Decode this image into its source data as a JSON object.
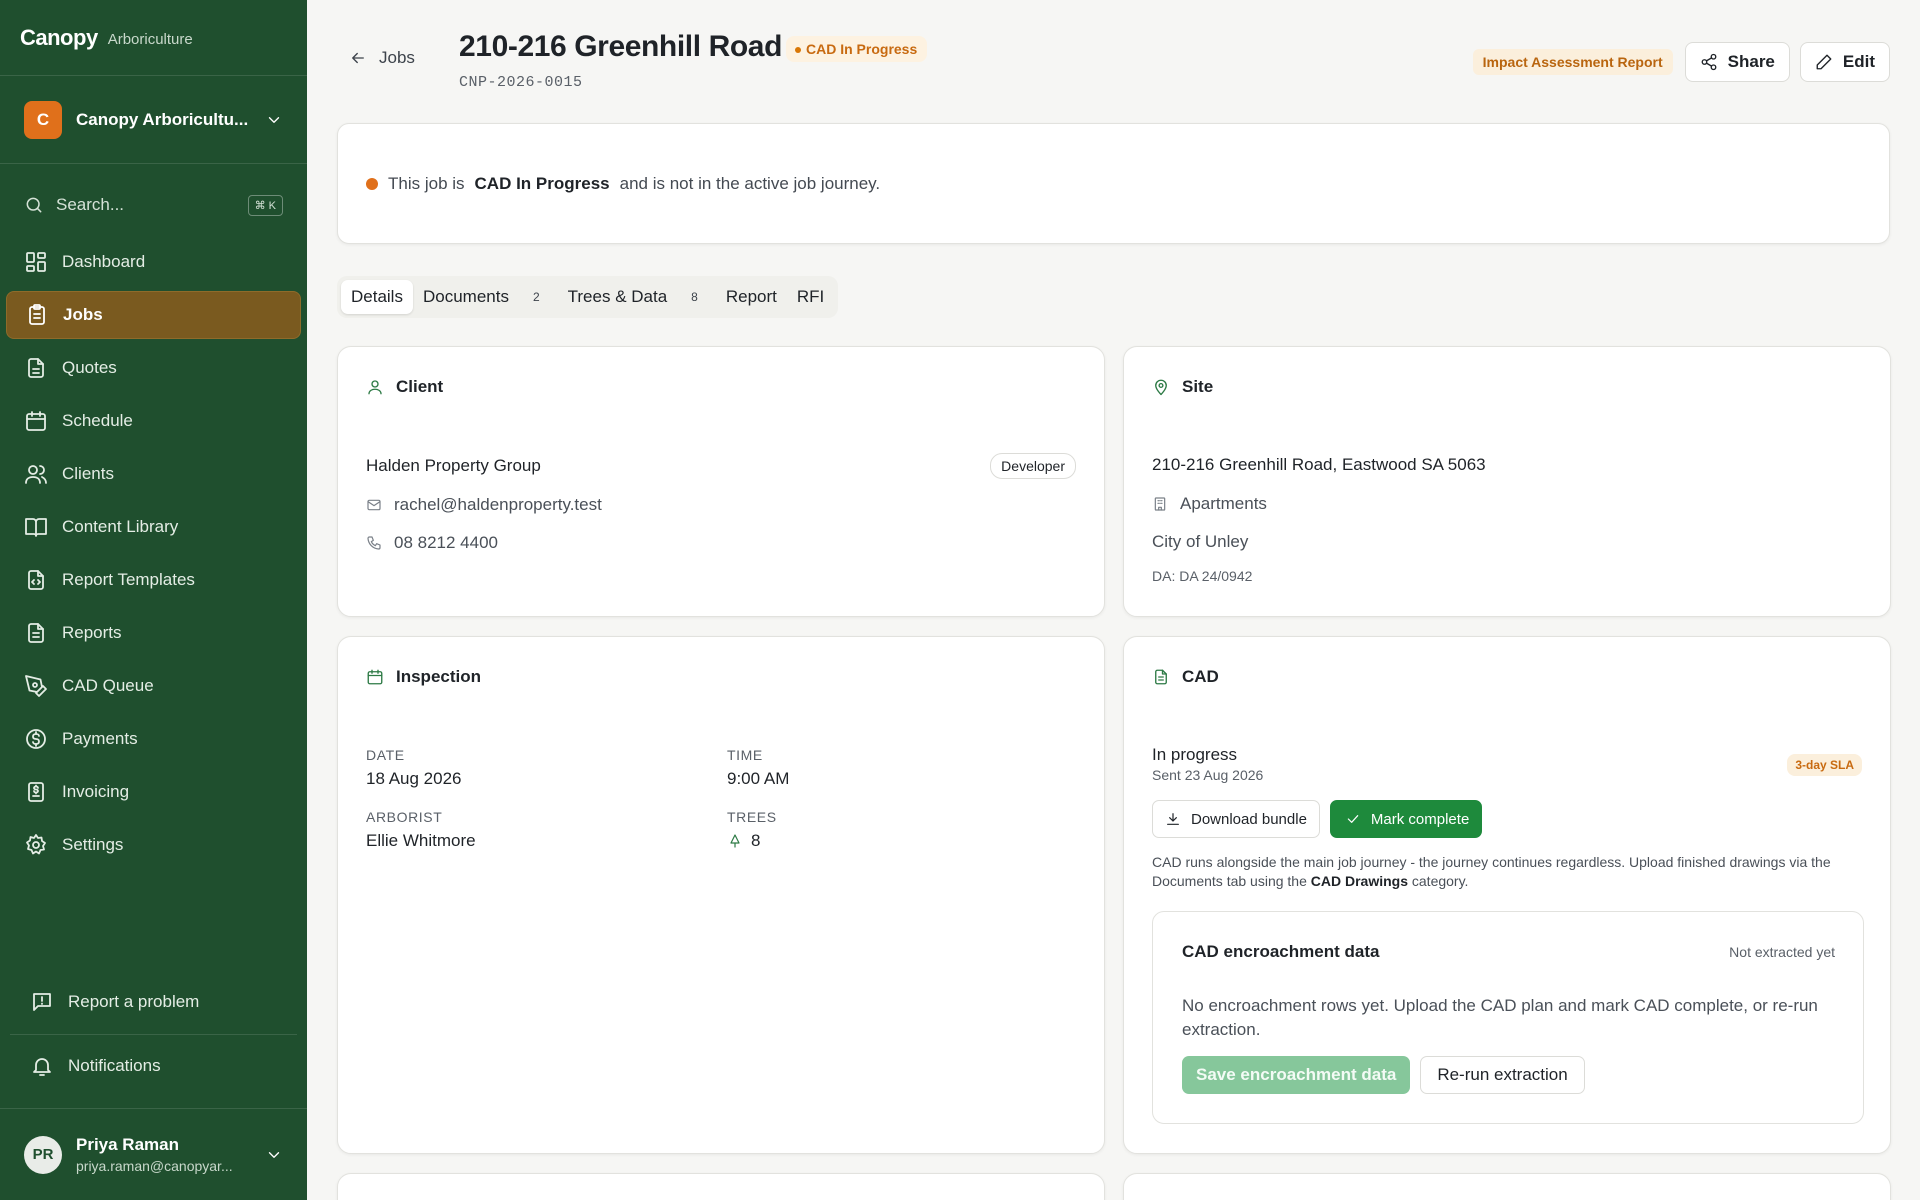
{
  "brand": {
    "name": "Canopy",
    "sub": "Arboriculture"
  },
  "org": {
    "initial": "C",
    "name": "Canopy Arboricultu..."
  },
  "search": {
    "placeholder": "Search...",
    "shortcut": "⌘ K"
  },
  "nav": {
    "items": [
      {
        "label": "Dashboard",
        "icon": "dashboard-icon"
      },
      {
        "label": "Jobs",
        "icon": "clipboard-icon",
        "active": true
      },
      {
        "label": "Quotes",
        "icon": "file-icon"
      },
      {
        "label": "Schedule",
        "icon": "calendar-icon"
      },
      {
        "label": "Clients",
        "icon": "users-icon"
      },
      {
        "label": "Content Library",
        "icon": "book-icon"
      },
      {
        "label": "Report Templates",
        "icon": "file-code-icon"
      },
      {
        "label": "Reports",
        "icon": "file-text-icon"
      },
      {
        "label": "CAD Queue",
        "icon": "pen-tool-icon"
      },
      {
        "label": "Payments",
        "icon": "dollar-circle-icon"
      },
      {
        "label": "Invoicing",
        "icon": "invoice-icon"
      },
      {
        "label": "Settings",
        "icon": "gear-icon"
      }
    ],
    "report_problem": "Report a problem",
    "notifications": "Notifications"
  },
  "user": {
    "initials": "PR",
    "name": "Priya Raman",
    "email": "priya.raman@canopyar..."
  },
  "header": {
    "back_label": "Jobs",
    "title": "210-216 Greenhill Road",
    "status_badge": "CAD In Progress",
    "job_id": "CNP-2026-0015",
    "report_chip": "Impact Assessment Report",
    "share_label": "Share",
    "edit_label": "Edit"
  },
  "alert": {
    "prefix": "This job is",
    "status": "CAD In Progress",
    "suffix": "and is not in the active job journey."
  },
  "tabs": [
    {
      "label": "Details",
      "active": true
    },
    {
      "label": "Documents",
      "count": "2"
    },
    {
      "label": "Trees & Data",
      "count": "8"
    },
    {
      "label": "Report"
    },
    {
      "label": "RFI"
    }
  ],
  "client": {
    "title": "Client",
    "name": "Halden Property Group",
    "type": "Developer",
    "email": "rachel@haldenproperty.test",
    "phone": "08 8212 4400"
  },
  "site": {
    "title": "Site",
    "address": "210-216 Greenhill Road, Eastwood SA 5063",
    "property_type": "Apartments",
    "council": "City of Unley",
    "da": "DA: DA 24/0942"
  },
  "inspection": {
    "title": "Inspection",
    "date_label": "DATE",
    "date": "18 Aug 2026",
    "time_label": "TIME",
    "time": "9:00 AM",
    "arborist_label": "ARBORIST",
    "arborist": "Ellie Whitmore",
    "trees_label": "TREES",
    "trees": "8"
  },
  "cad": {
    "title": "CAD",
    "status": "In progress",
    "sent": "Sent 23 Aug 2026",
    "sla": "3-day SLA",
    "download_label": "Download bundle",
    "complete_label": "Mark complete",
    "note_prefix": "CAD runs alongside the main job journey - the journey continues regardless. Upload finished drawings via the Documents tab using the",
    "note_strong": "CAD Drawings",
    "note_suffix": "category.",
    "encroachment": {
      "title": "CAD encroachment data",
      "status": "Not extracted yet",
      "text": "No encroachment rows yet. Upload the CAD plan and mark CAD complete, or re-run extraction.",
      "save_label": "Save encroachment data",
      "rerun_label": "Re-run extraction"
    }
  },
  "colors": {
    "sidebar": "#1f4f2e",
    "active_nav": "#7a5a1f",
    "accent_green": "#1e8a3c",
    "warning": "#e0701b"
  }
}
